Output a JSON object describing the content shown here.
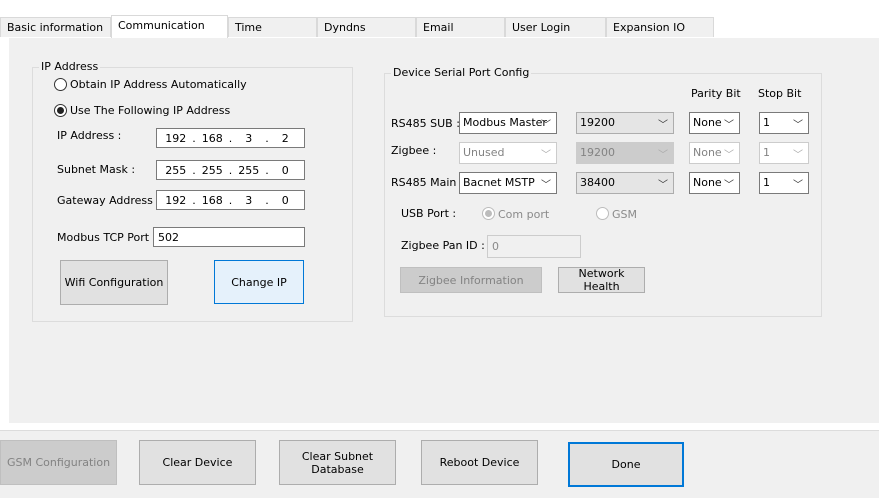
{
  "tabs": [
    "Basic information",
    "Communication",
    "Time",
    "Dyndns",
    "Email",
    "User Login",
    "Expansion IO"
  ],
  "active_tab": "Communication",
  "ip_group": {
    "legend": "IP Address",
    "radio_auto": "Obtain IP Address Automatically",
    "radio_manual": "Use The Following IP Address",
    "selected": "manual",
    "ip_label": "IP Address  :",
    "ip": [
      "192",
      "168",
      "3",
      "2"
    ],
    "subnet_label": "Subnet Mask  :",
    "subnet": [
      "255",
      "255",
      "255",
      "0"
    ],
    "gateway_label": "Gateway Address  :",
    "gateway": [
      "192",
      "168",
      "3",
      "0"
    ],
    "tcp_label": "Modbus TCP Port :",
    "tcp_port": "502",
    "wifi_button": "Wifi Configuration",
    "change_ip_button": "Change IP"
  },
  "serial_group": {
    "legend": "Device Serial Port Config",
    "parity_header": "Parity Bit",
    "stop_header": "Stop Bit",
    "rows": [
      {
        "label": "RS485 SUB :",
        "mode": "Modbus Master",
        "baud": "19200",
        "parity": "None",
        "stop": "1",
        "enabled": true
      },
      {
        "label": "Zigbee :",
        "mode": "Unused",
        "baud": "19200",
        "parity": "None",
        "stop": "1",
        "enabled": false
      },
      {
        "label": "RS485 Main :",
        "mode": "Bacnet MSTP",
        "baud": "38400",
        "parity": "None",
        "stop": "1",
        "enabled": true
      }
    ],
    "usb_label": "USB Port :",
    "usb_com": "Com port",
    "usb_gsm": "GSM",
    "pan_label": "Zigbee Pan ID :",
    "pan_id": "0",
    "zigbee_info_button": "Zigbee Information",
    "network_health_button": "Network Health"
  },
  "footer": {
    "gsm": "GSM Configuration",
    "clear_device": "Clear Device",
    "clear_subnet": "Clear Subnet Database",
    "reboot": "Reboot Device",
    "done": "Done"
  }
}
